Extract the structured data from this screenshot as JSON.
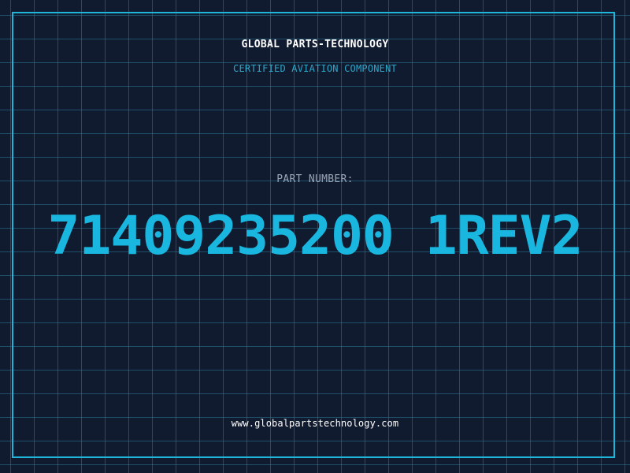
{
  "brand": {
    "name": "GLOBAL PARTS-TECHNOLOGY",
    "tagline": "CERTIFIED AVIATION COMPONENT"
  },
  "part": {
    "label": "PART NUMBER:",
    "number": "71409235200 1REV2"
  },
  "footer": {
    "website": "www.globalpartstechnology.com"
  },
  "colors": {
    "background": "#111b30",
    "accent": "#1fb4da",
    "grid": "#28788f",
    "text": "#ffffff",
    "muted": "#9aa6b6"
  }
}
